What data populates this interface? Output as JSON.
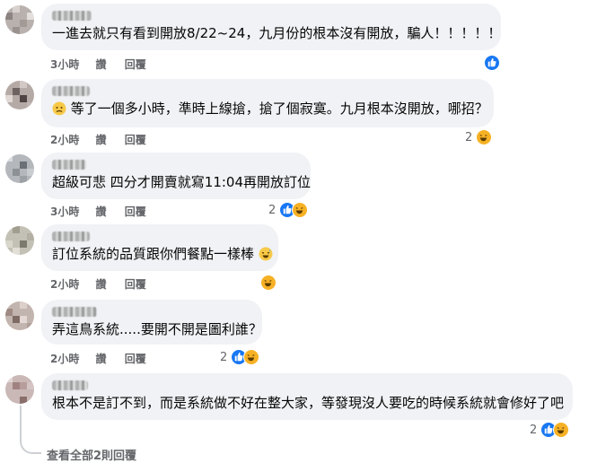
{
  "comments": [
    {
      "text": "一進去就只有看到開放8/22~24，九月份的根本沒有開放，騙人！！！！！",
      "time": "3小時",
      "like": "讚",
      "reply": "回覆",
      "reaction_count": "",
      "reactions": [
        "like"
      ]
    },
    {
      "text": "等了一個多小時，準時上線搶，搶了個寂寞。九月根本沒開放，哪招？",
      "time": "2小時",
      "like": "讚",
      "reply": "回覆",
      "reaction_count": "2",
      "reactions": [
        "haha"
      ],
      "leading_emoji": "worried-face"
    },
    {
      "text": "超級可悲 四分才開賣就寫11:04再開放訂位",
      "time": "3小時",
      "like": "讚",
      "reply": "回覆",
      "reaction_count": "2",
      "reactions": [
        "like",
        "haha"
      ]
    },
    {
      "text": "訂位系統的品質跟你們餐點一樣棒",
      "time": "2小時",
      "like": "讚",
      "reply": "回覆",
      "reaction_count": "",
      "reactions": [
        "haha"
      ],
      "trailing_emoji": "grin-sweat"
    },
    {
      "text": "弄這鳥系統.....要開不開是圖利誰？",
      "time": "2小時",
      "like": "讚",
      "reply": "回覆",
      "reaction_count": "2",
      "reactions": [
        "like",
        "haha"
      ]
    },
    {
      "text": "根本不是訂不到，而是系統做不好在整大家，等發現沒人要吃的時候系統就會修好了吧",
      "time": "2小時",
      "like": "讚",
      "reply": "回覆",
      "reaction_count": "2",
      "reactions": [
        "like",
        "haha"
      ]
    }
  ],
  "more_replies": "查看全部2則回覆",
  "colors": {
    "like": "#1877f2",
    "haha": "#f7b125",
    "bubble": "#f0f2f5",
    "meta": "#65676b"
  }
}
